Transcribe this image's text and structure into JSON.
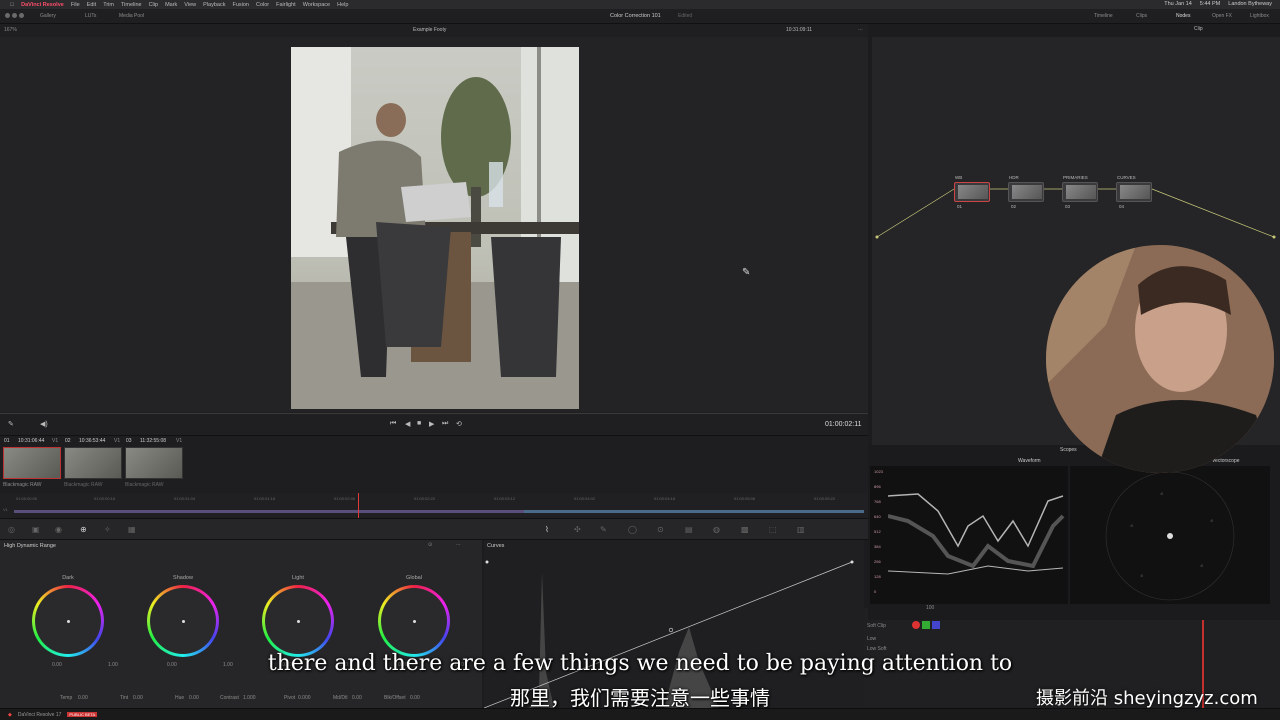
{
  "menubar": {
    "apple": "",
    "app_name": "DaVinci Resolve",
    "items": [
      "File",
      "Edit",
      "Trim",
      "Timeline",
      "Clip",
      "Mark",
      "View",
      "Playback",
      "Fusion",
      "Color",
      "Fairlight",
      "Workspace",
      "Help"
    ],
    "date": "Thu Jan 14",
    "time": "5:44 PM",
    "user": "Landon Bytheway"
  },
  "toolbar": {
    "gallery": "Gallery",
    "luts": "LUTs",
    "media_pool": "Media Pool",
    "project_title": "Color Correction 101",
    "edited": "Edited",
    "timeline_tab": "Timeline",
    "clips_tab": "Clips",
    "nodes_tab": "Nodes",
    "openfx_tab": "Open FX",
    "lightbox_tab": "Lightbox"
  },
  "viewer": {
    "zoom": "167%",
    "clip_name": "Example Footy",
    "timecode_top": "10:31:09:11",
    "timecode": "01:00:02:11"
  },
  "nodes": {
    "mode": "Clip",
    "items": [
      {
        "label": "WB",
        "num": "01"
      },
      {
        "label": "HDR",
        "num": "02"
      },
      {
        "label": "PRIMARIES",
        "num": "03"
      },
      {
        "label": "CURVES",
        "num": "04"
      }
    ]
  },
  "clips": {
    "header": [
      {
        "num": "01",
        "tc": "10:31:06:44",
        "v": "V1"
      },
      {
        "num": "02",
        "tc": "10:36:53:44",
        "v": "V1"
      },
      {
        "num": "03",
        "tc": "11:32:55:08",
        "v": "V1"
      }
    ],
    "names": [
      "Blackmagic RAW",
      "Blackmagic RAW",
      "Blackmagic RAW"
    ]
  },
  "timeline": {
    "ticks": [
      "01:00:00:00",
      "01:00:00:16",
      "01:00:01:04",
      "01:00:01:18",
      "01:00:02:06",
      "01:00:02:22",
      "01:00:03:12",
      "01:00:04:02",
      "01:00:04:18",
      "01:00:05:06",
      "01:00:05:22"
    ],
    "track": "V1"
  },
  "hdr": {
    "panel_title": "High Dynamic Range",
    "wheels": [
      {
        "name": "Dark",
        "exp": "0.00",
        "sat": "1.00"
      },
      {
        "name": "Shadow",
        "exp": "0.00",
        "sat": "1.00"
      },
      {
        "name": "Light",
        "exp": "0.00",
        "sat": "1.00"
      },
      {
        "name": "Global",
        "exp": "0.00",
        "sat": "1.00"
      }
    ],
    "bottom": {
      "temp_label": "Temp",
      "temp": "0.00",
      "tint_label": "Tint",
      "tint": "0.00",
      "hue_label": "Hue",
      "hue": "0.00",
      "contrast_label": "Contrast",
      "contrast": "1.000",
      "pivot_label": "Pivot",
      "pivot": "0.000",
      "mdtn_label": "Md/Dtl",
      "mdtn": "0.00",
      "bo_label": "Blk/Offset",
      "bo": "0.00"
    }
  },
  "curves": {
    "title": "Curves"
  },
  "scopes": {
    "title": "Scopes",
    "waveform": "Waveform",
    "vectorscope": "Vectorscope",
    "wf_ticks": [
      "1023",
      "896",
      "768",
      "640",
      "512",
      "384",
      "256",
      "128",
      "0"
    ],
    "bottom_value": "100"
  },
  "softclip": {
    "label": "Soft Clip",
    "low": "Low",
    "low_soft": "Low Soft"
  },
  "statusbar": {
    "app": "DaVinci Resolve 17",
    "badge": "PUBLIC BETA"
  },
  "subtitle": {
    "en": "there and there are a few things we need to be paying attention to",
    "zh": "那里，我们需要注意一些事情"
  },
  "watermark": "摄影前沿 sheyingzyz.com",
  "colors": {
    "accent": "#ff4d6a",
    "playhead": "#e03a3a",
    "node_link": "#c8c87a"
  }
}
